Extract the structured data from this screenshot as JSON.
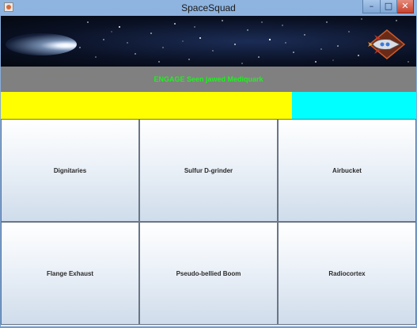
{
  "window": {
    "title": "SpaceSquad",
    "minimize_symbol": "–",
    "maximize_symbol": "□",
    "close_symbol": "✕"
  },
  "banner": {
    "left_image": "comet-image",
    "right_image": "rocket-icon"
  },
  "status": {
    "message": "ENGAGE Seen jawed Mediquark"
  },
  "progress": {
    "fill_fraction": 0.7,
    "fill_color": "#ffff00",
    "track_color": "#00ffff"
  },
  "buttons": [
    {
      "label": "Dignitaries"
    },
    {
      "label": "Sulfur D-grinder"
    },
    {
      "label": "Airbucket"
    },
    {
      "label": "Flange Exhaust"
    },
    {
      "label": "Pseudo-bellied Boom"
    },
    {
      "label": "Radiocortex"
    }
  ]
}
